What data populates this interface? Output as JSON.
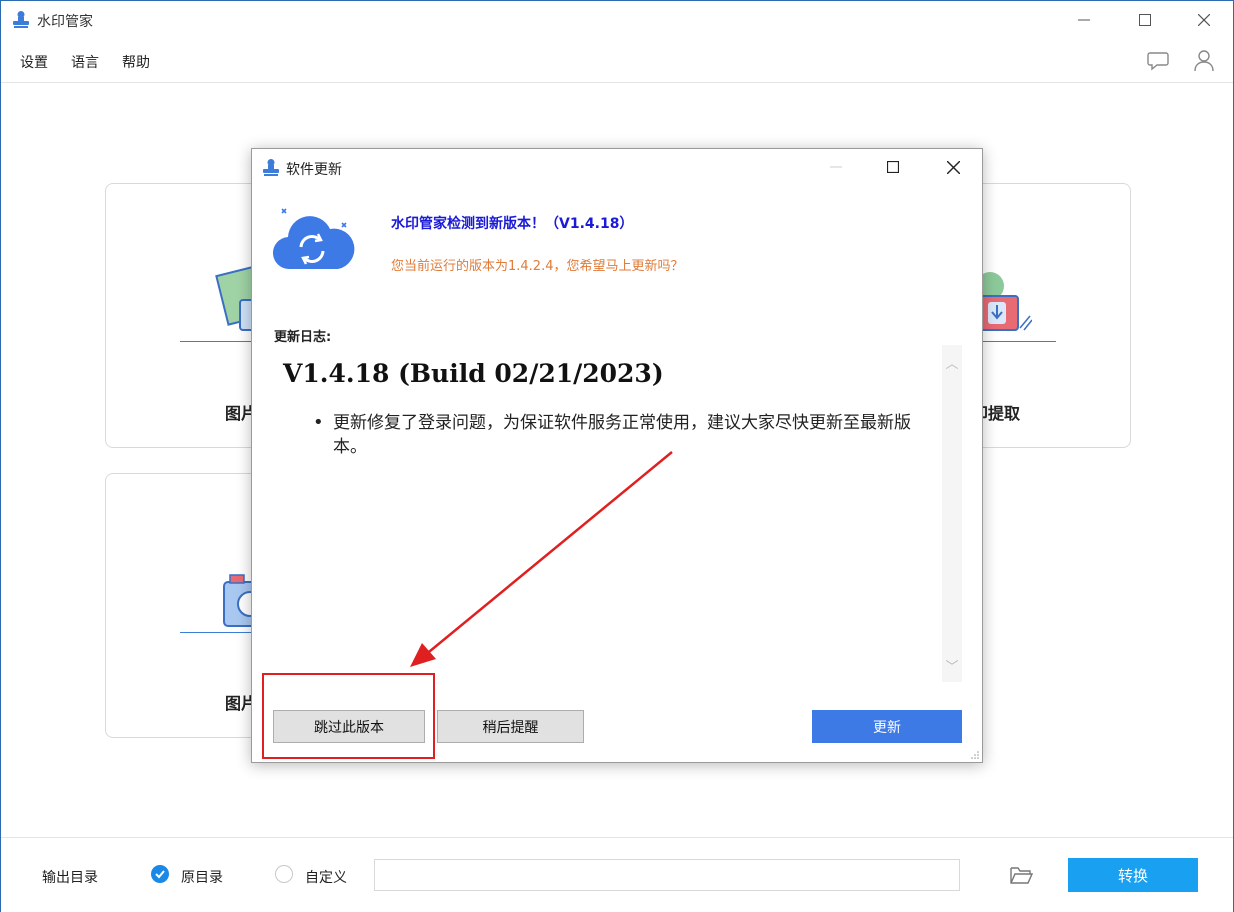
{
  "app": {
    "title": "水印管家",
    "icon": "stamp-icon"
  },
  "window_controls": {
    "minimize": "minimize-icon",
    "maximize": "maximize-icon",
    "close": "close-icon"
  },
  "menu": {
    "items": [
      {
        "label": "设置"
      },
      {
        "label": "语言"
      },
      {
        "label": "帮助"
      }
    ],
    "right_icons": [
      "chat-bubble-icon",
      "user-icon"
    ]
  },
  "cards": [
    {
      "label": "图片"
    },
    {
      "label": "印提取"
    },
    {
      "label": "图片"
    }
  ],
  "bottom": {
    "output_label": "输出目录",
    "option_original": "原目录",
    "option_custom": "自定义",
    "original_checked": true,
    "path_value": "",
    "convert_label": "转换"
  },
  "dialog": {
    "title": "软件更新",
    "headline": "水印管家检测到新版本！（V1.4.18）",
    "subline": "您当前运行的版本为1.4.2.4，您希望马上更新吗？",
    "log_title": "更新日志:",
    "log_version": "V1.4.18 (Build 02/21/2023)",
    "log_items": [
      "更新修复了登录问题，为保证软件服务正常使用，建议大家尽快更新至最新版本。"
    ],
    "buttons": {
      "skip": "跳过此版本",
      "later": "稍后提醒",
      "update": "更新"
    }
  },
  "colors": {
    "accent": "#1aa0f0",
    "update_button": "#3d7ae6",
    "headline": "#1a1ad8",
    "subline": "#e07b39",
    "annotation": "#e02020"
  }
}
